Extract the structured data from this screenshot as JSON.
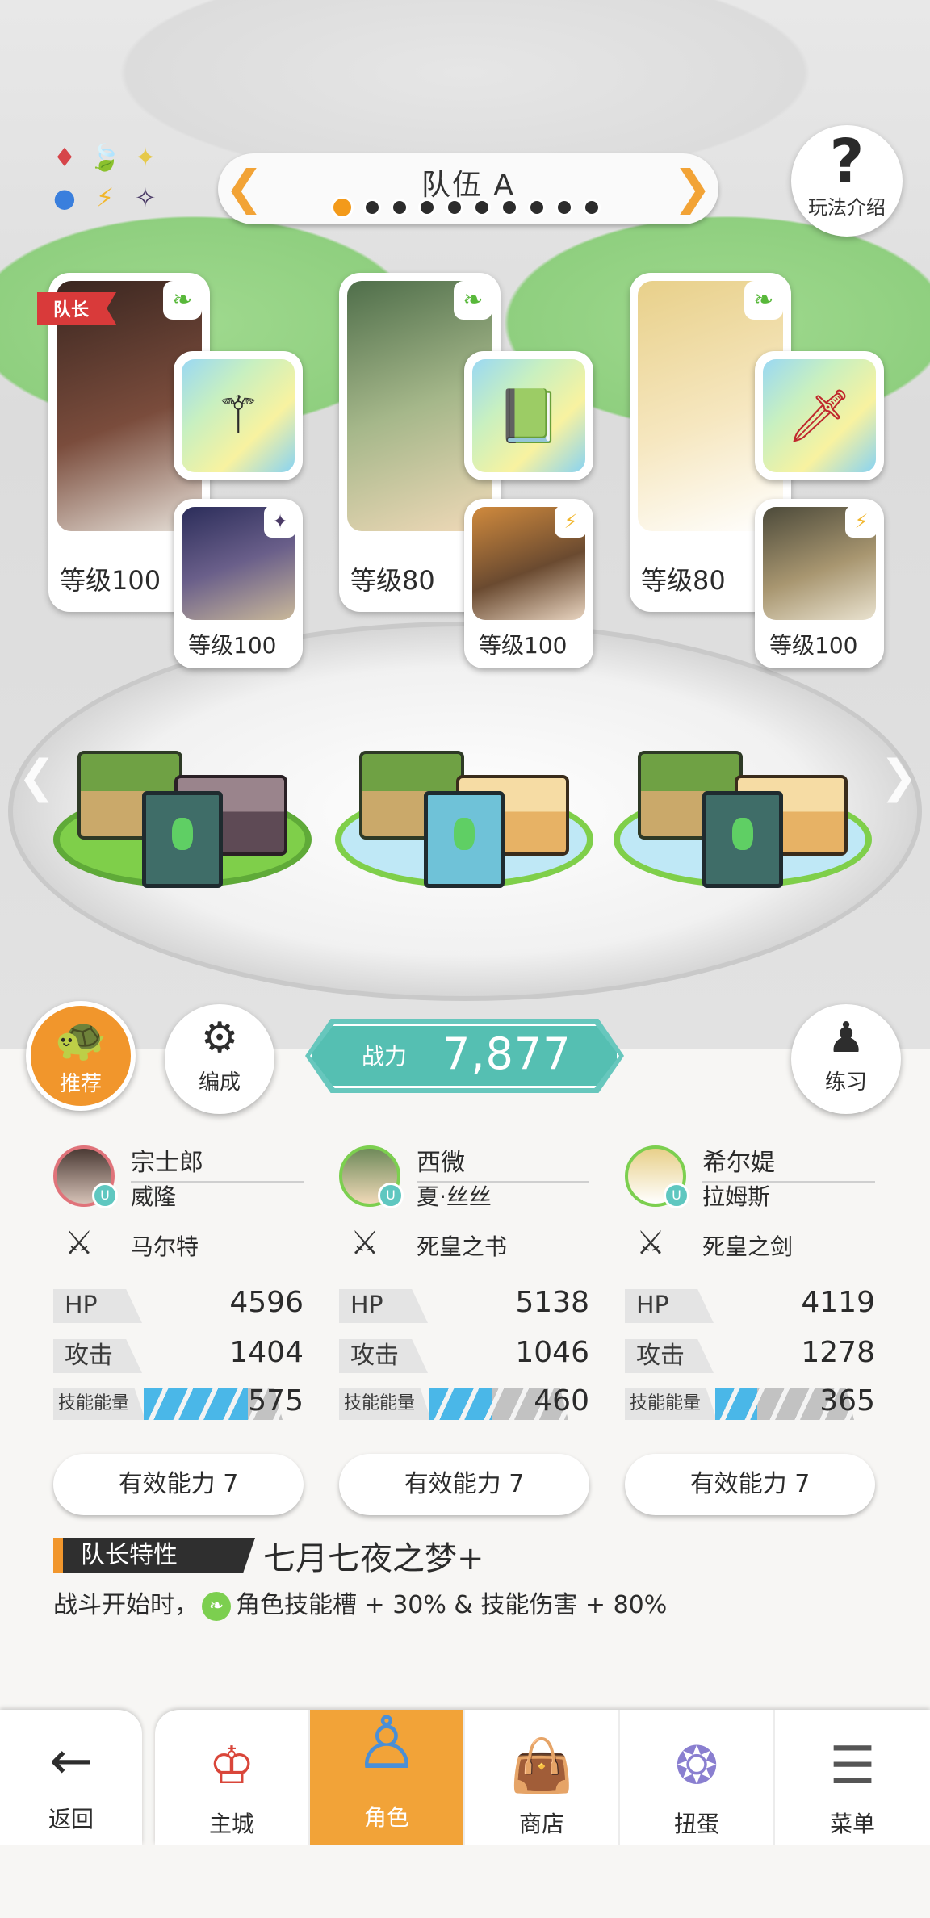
{
  "team": {
    "name": "队伍 A",
    "dot_count": 10,
    "active_dot": 0
  },
  "help": {
    "label": "玩法介绍"
  },
  "element_icons": [
    "♦",
    "🍃",
    "✦",
    "●",
    "⚡",
    "✧"
  ],
  "characters": [
    {
      "name": "宗士郎",
      "sub_name": "威隆",
      "weapon": "马尔特",
      "main_level": "等级100",
      "sub_level": "等级100",
      "leader_tag": "队长",
      "hp_label": "HP",
      "hp": "4596",
      "atk_label": "攻击",
      "atk": "1404",
      "energy_label": "技能能量",
      "energy": "575",
      "energy_fraction": 0.75,
      "ability": "有效能力 7",
      "colors": {
        "portrait": "#5a3a30",
        "sub_portrait": "#3d3a6b"
      }
    },
    {
      "name": "西微",
      "sub_name": "夏·丝丝",
      "weapon": "死皇之书",
      "main_level": "等级80",
      "sub_level": "等级100",
      "hp_label": "HP",
      "hp": "5138",
      "atk_label": "攻击",
      "atk": "1046",
      "energy_label": "技能能量",
      "energy": "460",
      "energy_fraction": 0.45,
      "ability": "有效能力 7",
      "colors": {
        "portrait": "#6f8a5a",
        "sub_portrait": "#b07a4a"
      }
    },
    {
      "name": "希尔媞",
      "sub_name": "拉姆斯",
      "weapon": "死皇之剑",
      "main_level": "等级80",
      "sub_level": "等级100",
      "hp_label": "HP",
      "hp": "4119",
      "atk_label": "攻击",
      "atk": "1278",
      "energy_label": "技能能量",
      "energy": "365",
      "energy_fraction": 0.3,
      "ability": "有效能力 7",
      "colors": {
        "portrait": "#f2dfa1",
        "sub_portrait": "#7d6a45"
      }
    }
  ],
  "actions": {
    "recommend": "推荐",
    "formation": "编成",
    "practice": "练习"
  },
  "power": {
    "label": "战力",
    "value": "7,877"
  },
  "leader_trait": {
    "tag": "队长特性",
    "name": "七月七夜之梦+",
    "desc_prefix": "战斗开始时，",
    "desc_suffix": "角色技能槽 + 30% & 技能伤害 + 80%"
  },
  "nav": {
    "back": "返回",
    "items": [
      "主城",
      "角色",
      "商店",
      "扭蛋",
      "菜单"
    ],
    "active_index": 1
  },
  "colors": {
    "accent": "#f1962c",
    "teal": "#55bfb2",
    "energy_blue": "#4ab7e8",
    "leaf_green": "#58b83a"
  }
}
